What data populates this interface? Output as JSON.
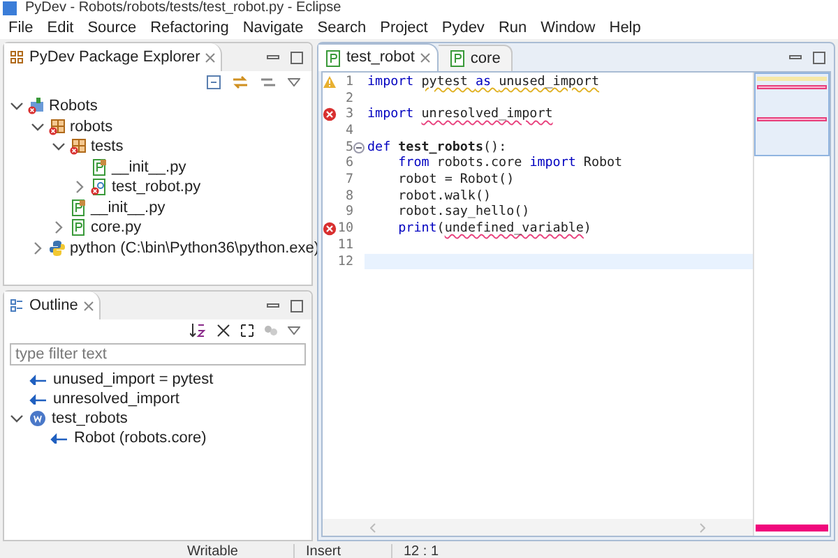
{
  "window": {
    "title": "PyDev - Robots/robots/tests/test_robot.py - Eclipse"
  },
  "menu": [
    "File",
    "Edit",
    "Source",
    "Refactoring",
    "Navigate",
    "Search",
    "Project",
    "Pydev",
    "Run",
    "Window",
    "Help"
  ],
  "explorer": {
    "title": "PyDev Package Explorer",
    "tree": [
      {
        "label": "Robots",
        "kind": "project",
        "expanded": true,
        "error": true,
        "children": [
          {
            "label": "robots",
            "kind": "package",
            "expanded": true,
            "error": true,
            "children": [
              {
                "label": "tests",
                "kind": "package",
                "expanded": true,
                "error": true,
                "children": [
                  {
                    "label": "__init__.py",
                    "kind": "init",
                    "error": false
                  },
                  {
                    "label": "test_robot.py",
                    "kind": "module",
                    "expanded": false,
                    "error": true
                  }
                ]
              },
              {
                "label": "__init__.py",
                "kind": "init",
                "error": false
              },
              {
                "label": "core.py",
                "kind": "file",
                "expanded": false,
                "error": false
              }
            ]
          },
          {
            "label": "python  (C:\\bin\\Python36\\python.exe)",
            "kind": "python",
            "expanded": false,
            "error": false
          }
        ]
      }
    ]
  },
  "outline": {
    "title": "Outline",
    "filter": {
      "placeholder": "type filter text"
    },
    "tree": [
      {
        "label": "unused_import = pytest",
        "kind": "import"
      },
      {
        "label": "unresolved_import",
        "kind": "import"
      },
      {
        "label": "test_robots",
        "kind": "function",
        "expanded": true,
        "children": [
          {
            "label": "Robot (robots.core)",
            "kind": "import"
          }
        ]
      }
    ]
  },
  "editor": {
    "tabs": [
      {
        "label": "test_robot",
        "selected": true
      },
      {
        "label": "core",
        "selected": false
      }
    ],
    "lines": [
      {
        "number": "1",
        "kind": "warning",
        "tokens": [
          {
            "text": "import ",
            "kind": "keyword"
          },
          {
            "text": "pytest ",
            "kind": "warning"
          },
          {
            "text": "as ",
            "kind": "keyword-warning"
          },
          {
            "text": "unused_import",
            "kind": "warning"
          }
        ]
      },
      {
        "number": "2",
        "kind": "plain"
      },
      {
        "number": "3",
        "kind": "error",
        "tokens": [
          {
            "text": "import ",
            "kind": "keyword"
          },
          {
            "text": "unresolved_import",
            "kind": "error"
          }
        ]
      },
      {
        "number": "4",
        "kind": "plain"
      },
      {
        "number": "5",
        "kind": "fold",
        "tokens": [
          {
            "text": "def ",
            "kind": "keyword"
          },
          {
            "text": "test_robots",
            "kind": "bold"
          },
          {
            "text": "():",
            "kind": "plain"
          }
        ]
      },
      {
        "number": "6",
        "kind": "plain",
        "tokens": [
          {
            "text": "    from",
            "kind": "keyword"
          },
          {
            "text": " robots.core ",
            "kind": "plain"
          },
          {
            "text": "import",
            "kind": "keyword"
          },
          {
            "text": " Robot",
            "kind": "plain"
          }
        ]
      },
      {
        "number": "7",
        "kind": "plain",
        "tokens": [
          {
            "text": "    robot = Robot()",
            "kind": "plain"
          }
        ]
      },
      {
        "number": "8",
        "kind": "plain",
        "tokens": [
          {
            "text": "    robot.walk()",
            "kind": "plain"
          }
        ]
      },
      {
        "number": "9",
        "kind": "plain",
        "tokens": [
          {
            "text": "    robot.say_hello()",
            "kind": "plain"
          }
        ]
      },
      {
        "number": "10",
        "kind": "error",
        "tokens": [
          {
            "text": "    print",
            "kind": "keyword"
          },
          {
            "text": "(",
            "kind": "plain"
          },
          {
            "text": "undefined_variable",
            "kind": "error"
          },
          {
            "text": ")",
            "kind": "plain"
          }
        ]
      },
      {
        "number": "11",
        "kind": "plain"
      },
      {
        "number": "12",
        "kind": "plain",
        "current": true
      }
    ]
  },
  "status_bar": [
    "Writable",
    "Insert",
    "12 : 1"
  ]
}
